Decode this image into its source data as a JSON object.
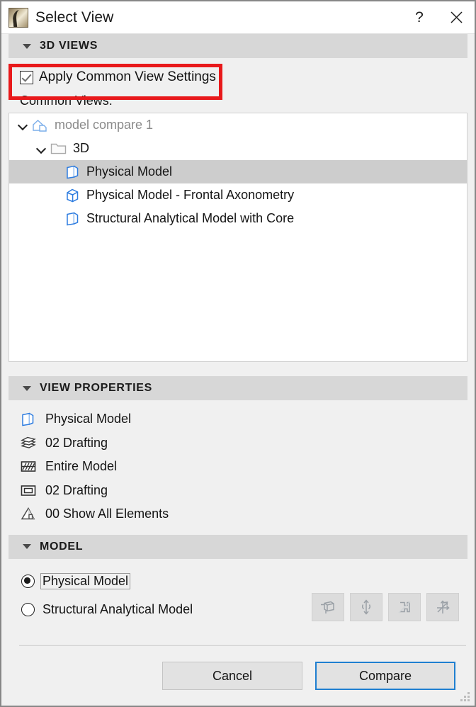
{
  "window": {
    "title": "Select View",
    "app_icon": "archicad-logo-icon",
    "help_label": "?",
    "close_label": "✕"
  },
  "sections": {
    "views3d": {
      "title": "3D VIEWS",
      "apply_common": {
        "label": "Apply Common View Settings",
        "checked": true,
        "highlight_color": "#e8191b"
      },
      "common_views_label": "Common Views:",
      "tree": [
        {
          "label": "model compare 1",
          "icon": "project-house-icon",
          "level": 0,
          "expanded": true,
          "selected": false,
          "muted": true
        },
        {
          "label": "3D",
          "icon": "folder-icon",
          "level": 1,
          "expanded": true,
          "selected": false,
          "muted": false
        },
        {
          "label": "Physical Model",
          "icon": "view-3d-box-icon",
          "level": 2,
          "expanded": false,
          "selected": true,
          "muted": false
        },
        {
          "label": "Physical Model - Frontal Axonometry",
          "icon": "view-axonometry-box-icon",
          "level": 2,
          "expanded": false,
          "selected": false,
          "muted": false
        },
        {
          "label": "Structural Analytical Model with Core",
          "icon": "view-3d-box-icon",
          "level": 2,
          "expanded": false,
          "selected": false,
          "muted": false
        }
      ]
    },
    "view_properties": {
      "title": "VIEW PROPERTIES",
      "rows": [
        {
          "label": "Physical Model",
          "icon": "model-box-icon"
        },
        {
          "label": "02 Drafting",
          "icon": "layers-icon"
        },
        {
          "label": "Entire Model",
          "icon": "partial-structure-icon"
        },
        {
          "label": "02 Drafting",
          "icon": "model-view-options-icon"
        },
        {
          "label": "00 Show All Elements",
          "icon": "renovation-filter-icon"
        }
      ]
    },
    "model": {
      "title": "MODEL",
      "options": [
        {
          "label": "Physical Model",
          "selected": true,
          "focused": true
        },
        {
          "label": "Structural Analytical Model",
          "selected": false,
          "focused": false
        }
      ],
      "tools": [
        {
          "icon": "sam-display-box-icon",
          "enabled": false
        },
        {
          "icon": "sam-vertical-arrows-icon",
          "enabled": false
        },
        {
          "icon": "sam-profile-icon",
          "enabled": false
        },
        {
          "icon": "sam-axes-icon",
          "enabled": false
        }
      ]
    }
  },
  "footer": {
    "cancel_label": "Cancel",
    "compare_label": "Compare",
    "default_button": "Compare",
    "accent_color": "#1f7fd0",
    "resize_grip": "resize-grip-icon"
  }
}
